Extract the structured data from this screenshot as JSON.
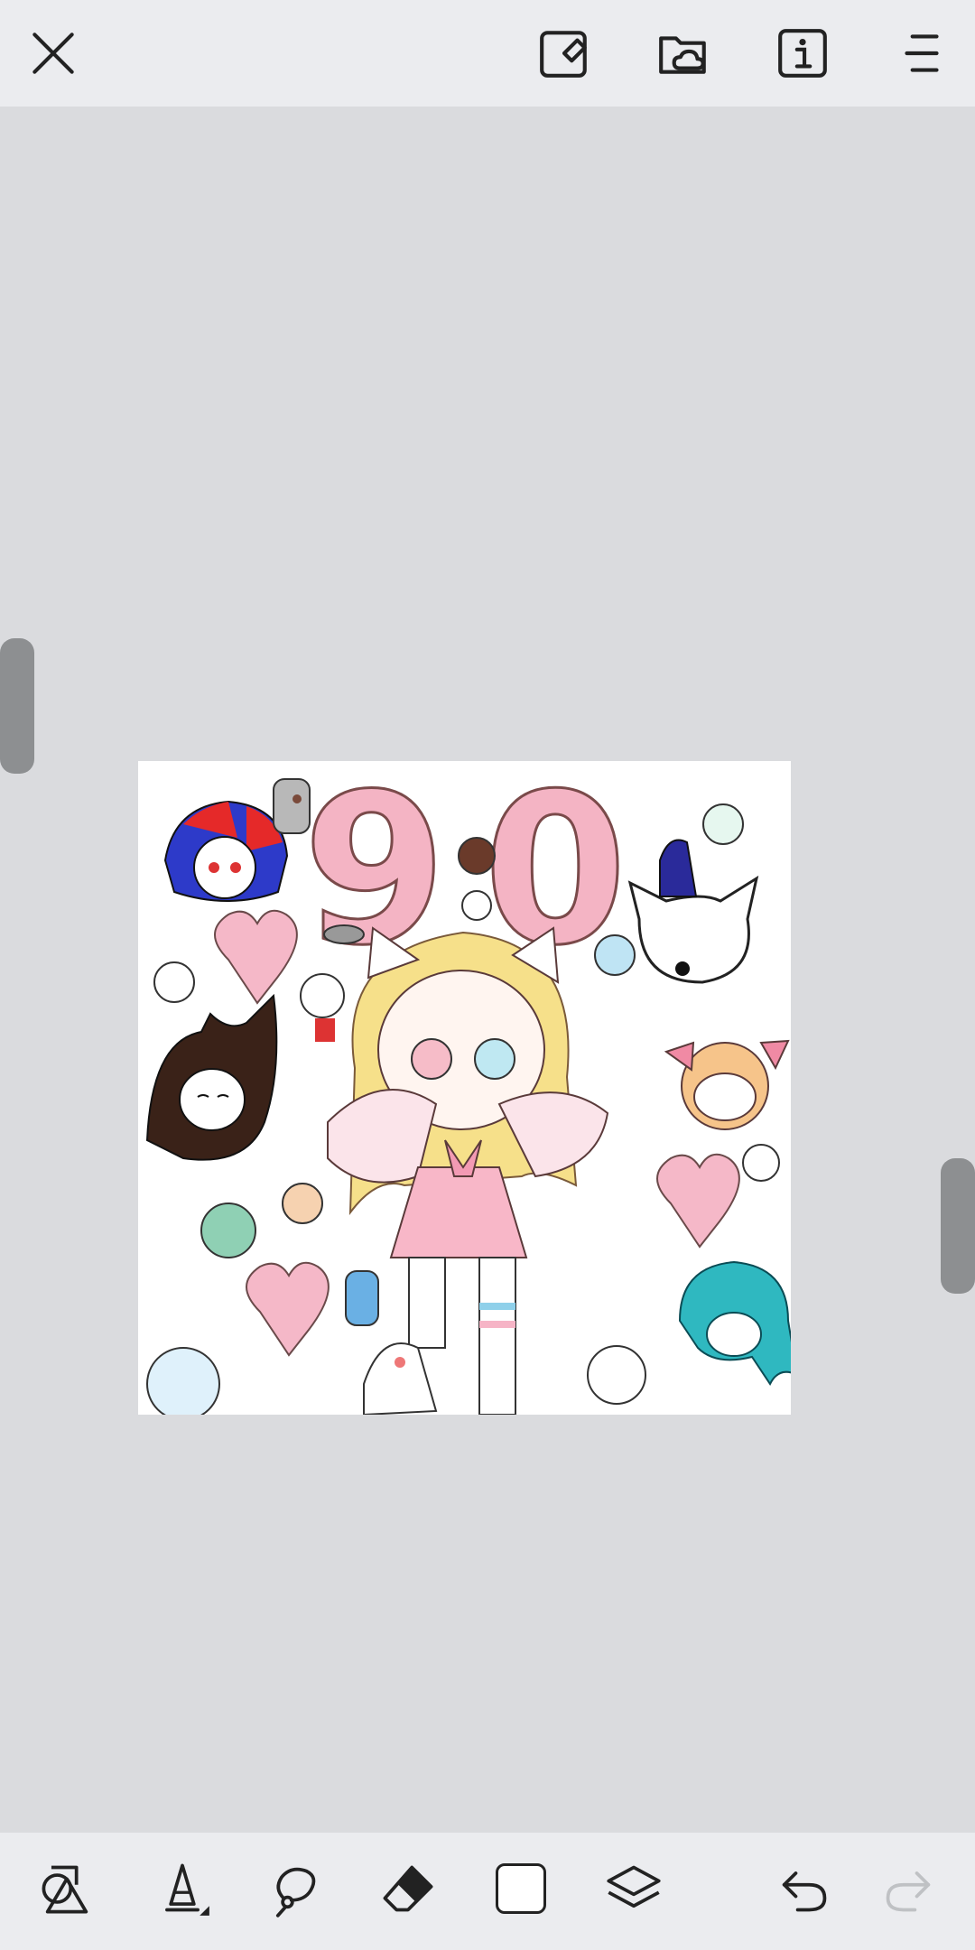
{
  "colors": {
    "toolbar_bg": "#ebecef",
    "workspace_bg": "#dadbde",
    "canvas_bg": "#ffffff",
    "handle": "#8d8f91",
    "icon": "#222222",
    "icon_disabled": "#bfc1c4",
    "current_brush_color": "#ffffff"
  },
  "top_toolbar": {
    "close": "close-icon",
    "canvas_export": "canvas-export-icon",
    "cloud_folder": "cloud-folder-icon",
    "info": "info-icon",
    "menu": "menu-icon"
  },
  "canvas": {
    "drawing_text": "90"
  },
  "bottom_toolbar": {
    "shapes": "shapes-icon",
    "brush": "brush-icon",
    "lasso": "lasso-icon",
    "eraser": "eraser-icon",
    "color": "color-swatch",
    "layers": "layers-icon",
    "undo": "undo-icon",
    "redo": "redo-icon",
    "redo_enabled": false
  }
}
